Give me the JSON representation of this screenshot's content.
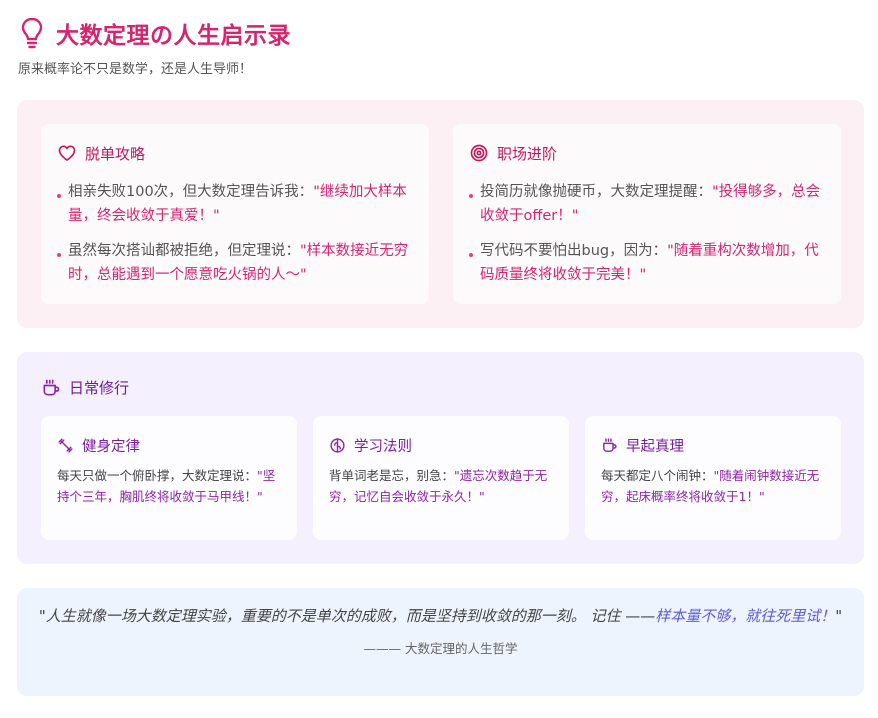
{
  "header": {
    "icon": "lightbulb-icon",
    "title": "大数定理の人生启示录",
    "subtitle": "原来概率论不只是数学，还是人生导师！"
  },
  "colors": {
    "title": "#d6246e",
    "pink_panel": "#fdf0f5",
    "purple_panel": "#f4f0fd",
    "blue_panel": "#eef4fd",
    "pink_quote": "#d6246e",
    "purple_quote": "#8e24aa"
  },
  "cards": {
    "dating": {
      "icon": "heart-icon",
      "title": "脱单攻略",
      "items": [
        {
          "text": "相亲失败100次，但大数定理告诉我：",
          "quote": "\"继续加大样本量，终会收敛于真爱！\""
        },
        {
          "text": "虽然每次搭讪都被拒绝，但定理说：",
          "quote": "\"样本数接近无穷时，总能遇到一个愿意吃火锅的人～\""
        }
      ]
    },
    "career": {
      "icon": "target-icon",
      "title": "职场进阶",
      "items": [
        {
          "text": "投简历就像抛硬币，大数定理提醒：",
          "quote": "\"投得够多，总会收敛于offer！\""
        },
        {
          "text": "写代码不要怕出bug，因为：",
          "quote": "\"随着重构次数增加，代码质量终将收敛于完美！\""
        }
      ]
    }
  },
  "daily": {
    "icon": "coffee-icon",
    "title": "日常修行",
    "cards": [
      {
        "icon": "dumbbell-icon",
        "title": "健身定律",
        "text": "每天只做一个俯卧撑，大数定理说：",
        "quote": "\"坚持个三年，胸肌终将收敛于马甲线！\""
      },
      {
        "icon": "brain-icon",
        "title": "学习法则",
        "text": "背单词老是忘，别急：",
        "quote": "\"遗忘次数趋于无穷，记忆自会收敛于永久！\""
      },
      {
        "icon": "coffee-icon",
        "title": "早起真理",
        "text": "每天都定八个闹钟：",
        "quote": "\"随着闹钟数接近无穷，起床概率终将收敛于1！\""
      }
    ]
  },
  "motto": {
    "text": "\"人生就像一场大数定理实验，重要的不是单次的成败，而是坚持到收敛的那一刻。 记住 ——",
    "highlight": "样本量不够，就往死里试！",
    "end": "\"",
    "signature": "——— 大数定理的人生哲学"
  }
}
